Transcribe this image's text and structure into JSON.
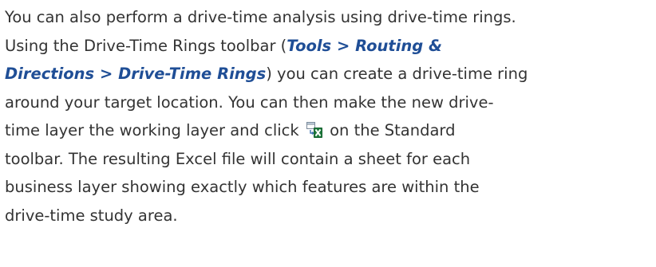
{
  "paragraph": {
    "line1": "You can also perform a drive-time analysis using drive-time rings.",
    "line2_prefix": "Using the Drive-Time Rings toolbar (",
    "menu_tools": "Tools",
    "sep1": " > ",
    "menu_routing": "Routing &",
    "menu_directions": "Directions",
    "sep2": " > ",
    "menu_rings": "Drive-Time Rings",
    "line3_suffix": ") you can create a drive-time ring",
    "line4": "around your target location. You can then make the new drive-",
    "line5_prefix": "time layer the working layer and click ",
    "line5_suffix": " on the Standard",
    "line6": "toolbar. The resulting Excel file will contain a sheet for each",
    "line7": "business layer showing exactly which features are within the",
    "line8": "drive-time study area."
  },
  "icons": {
    "export_excel": "export-to-excel-icon"
  },
  "colors": {
    "body_text": "#333333",
    "menu_text": "#1f4e96",
    "excel_green": "#1e7a3c"
  }
}
